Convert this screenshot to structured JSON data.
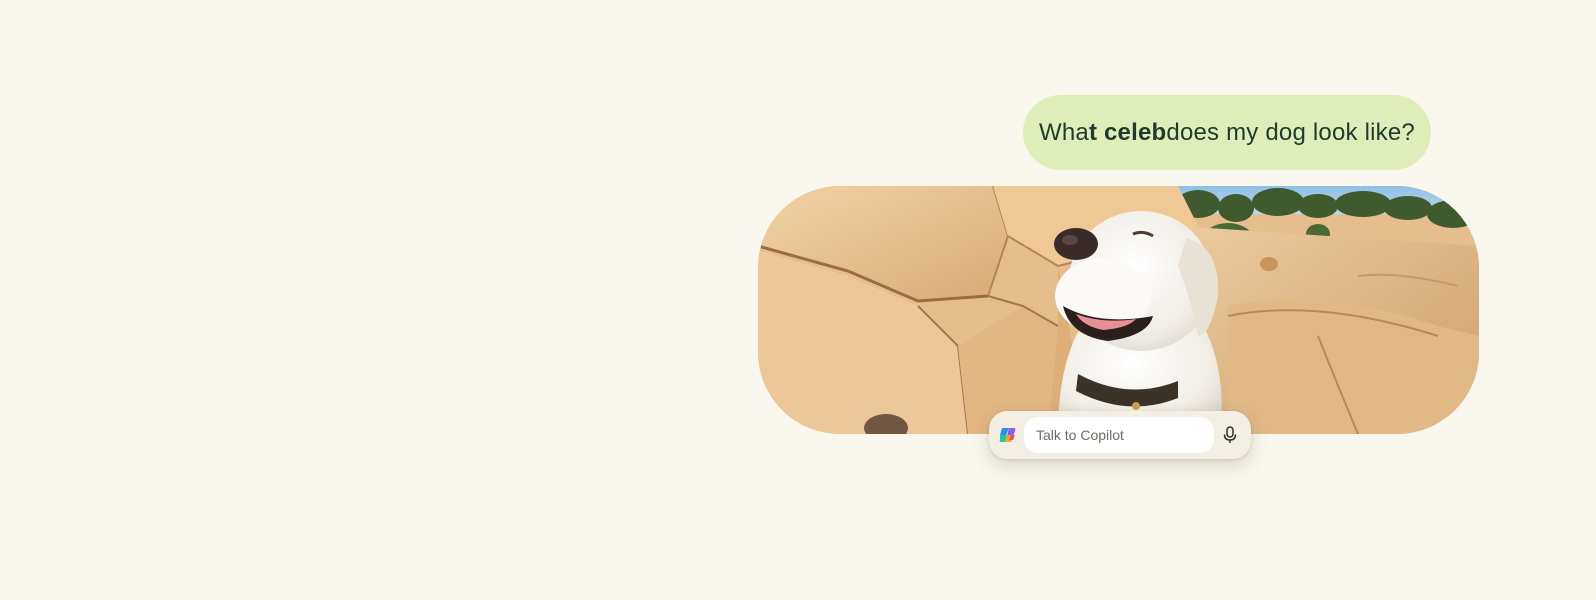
{
  "message": {
    "prefix": "Wha",
    "bold_a": "t celeb",
    "suffix": " does my dog look like?",
    "full_text": "What celeb does my dog look like?"
  },
  "photo": {
    "subject": "white labrador dog on sandstone rocks"
  },
  "composer": {
    "placeholder": "Talk to Copilot",
    "logo_icon": "copilot-logo-icon",
    "mic_icon": "microphone-icon"
  },
  "colors": {
    "background": "#faf7ef",
    "bubble": "#dfeeb8",
    "bubble_text": "#1f3a2e"
  }
}
